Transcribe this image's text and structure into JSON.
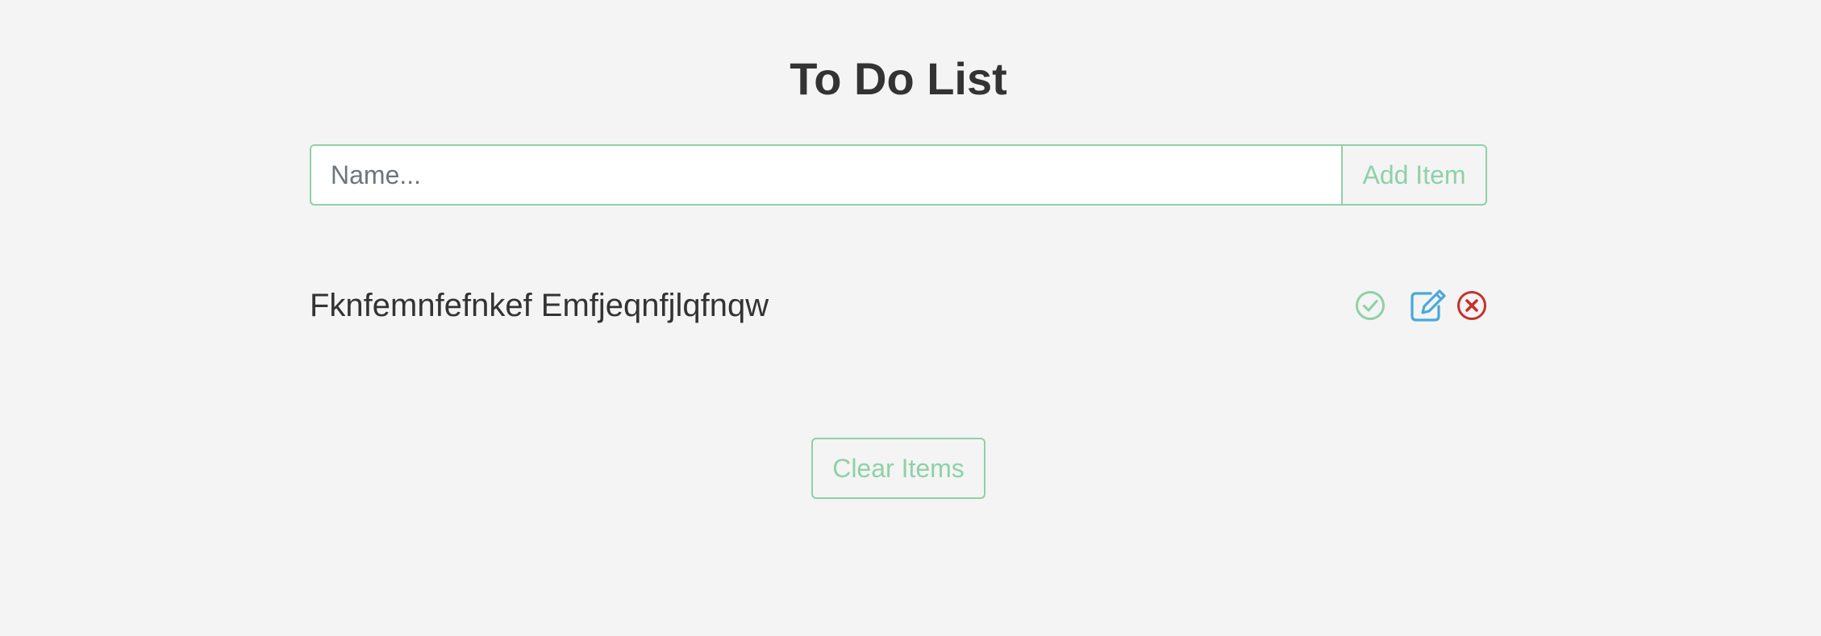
{
  "header": {
    "title": "To Do List"
  },
  "form": {
    "placeholder": "Name...",
    "value": "",
    "add_button_label": "Add Item"
  },
  "items": [
    {
      "text": "Fknfemnfefnkef Emfjeqnfjlqfnqw",
      "icons": [
        "check-circle-icon",
        "edit-icon",
        "close-circle-icon"
      ]
    }
  ],
  "footer": {
    "clear_button_label": "Clear Items"
  },
  "colors": {
    "background": "#f4f4f4",
    "accent_green": "#8fd1a8",
    "edit_blue": "#4aa8d8",
    "delete_red": "#c9302c",
    "text": "#333333"
  }
}
